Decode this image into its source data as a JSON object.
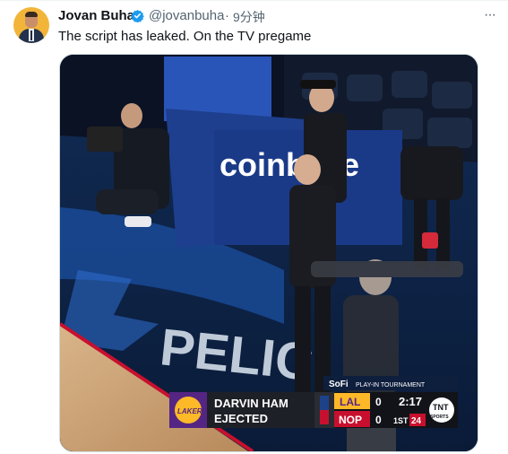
{
  "author": {
    "display_name": "Jovan Buha",
    "handle": "@jovanbuha",
    "separator": "·",
    "timestamp": "9分钟",
    "verified_icon": "verified-badge-icon"
  },
  "tweet": {
    "text": "The script has leaked. On the TV pregame",
    "more_icon": "more-options-icon",
    "more_glyph": "···"
  },
  "media": {
    "court_sign_text": "coinbase",
    "floor_text": "PELIC",
    "scoreboard": {
      "network": "SoFi",
      "event": "PLAY-IN TOURNAMENT",
      "team_logo_text": "LAKERS",
      "headline_line1": "DARVIN HAM",
      "headline_line2": "EJECTED",
      "teams": [
        {
          "abbr": "LAL",
          "score": "0"
        },
        {
          "abbr": "NOP",
          "score": "0"
        }
      ],
      "clock": "2:17",
      "period": "1ST",
      "shot_clock": "24",
      "broadcaster": "TNT",
      "broadcaster_sub": "SPORTS"
    }
  },
  "colors": {
    "lakers_purple": "#552583",
    "lakers_gold": "#fdb927",
    "pelicans_red": "#c8102e",
    "verified_blue": "#1d9bf0"
  }
}
